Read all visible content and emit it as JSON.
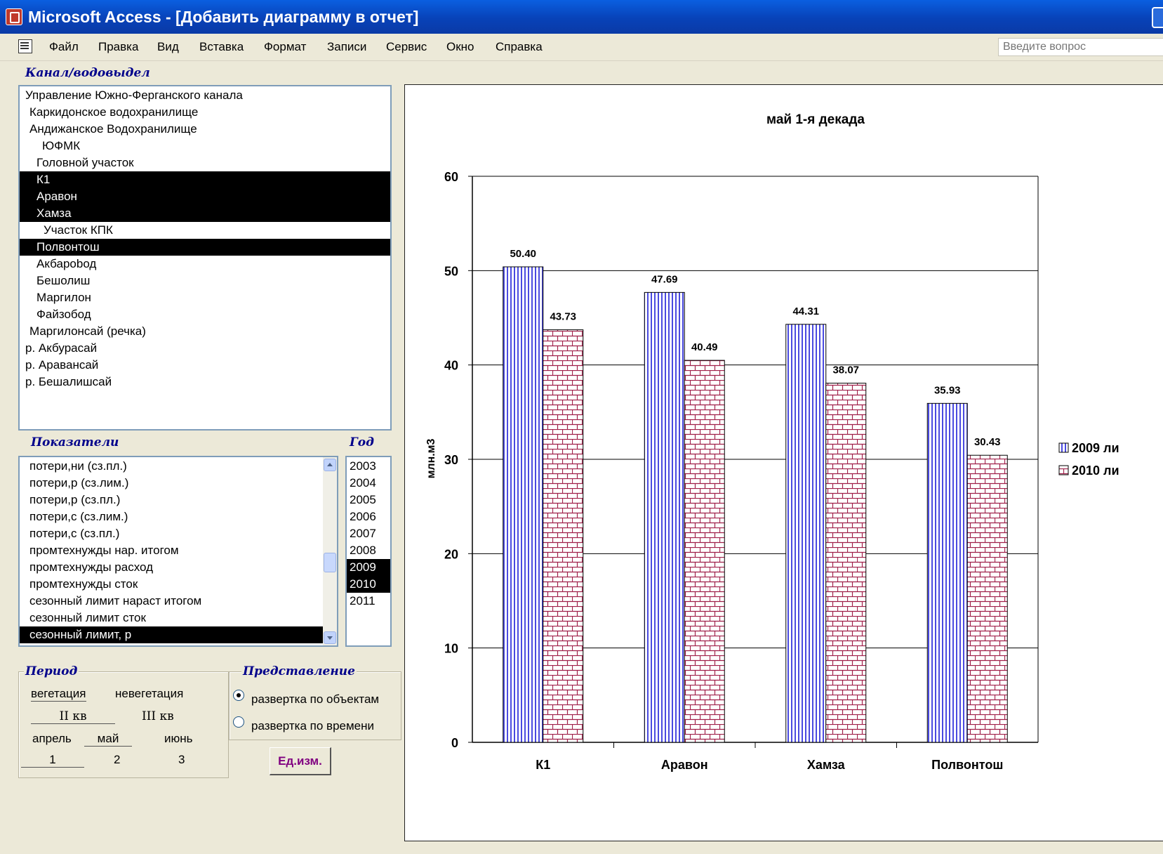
{
  "window": {
    "title": "Microsoft Access - [Добавить диаграмму в отчет]"
  },
  "menu": {
    "items": [
      "Файл",
      "Правка",
      "Вид",
      "Вставка",
      "Формат",
      "Записи",
      "Сервис",
      "Окно",
      "Справка"
    ],
    "help_placeholder": "Введите вопрос"
  },
  "channel": {
    "label": "Канал/водовыдел",
    "items": [
      {
        "label": "Управление Южно-Ферганского канала",
        "selected": false
      },
      {
        "label": "Каркидонское водохранилище",
        "selected": false
      },
      {
        "label": "Андижанское Водохранилище",
        "selected": false
      },
      {
        "label": "ЮФМК",
        "selected": false
      },
      {
        "label": "Головной участок",
        "selected": false
      },
      {
        "label": "К1",
        "selected": true
      },
      {
        "label": "Аравон",
        "selected": true
      },
      {
        "label": "Хамза",
        "selected": true
      },
      {
        "label": "Участок КПК",
        "selected": false
      },
      {
        "label": "Полвонтош",
        "selected": true
      },
      {
        "label": "Акбарobод",
        "selected": false
      },
      {
        "label": "Бешолиш",
        "selected": false
      },
      {
        "label": "Маргилон",
        "selected": false
      },
      {
        "label": "Файзобод",
        "selected": false
      },
      {
        "label": "Маргилонсай (речка)",
        "selected": false
      },
      {
        "label": "р. Акбурасай",
        "selected": false
      },
      {
        "label": "р. Аравансай",
        "selected": false
      },
      {
        "label": "р. Бешалишсай",
        "selected": false
      }
    ]
  },
  "indicators": {
    "label": "Показатели",
    "items": [
      {
        "label": "потери,ни (сз.пл.)",
        "selected": false
      },
      {
        "label": "потери,р (сз.лим.)",
        "selected": false
      },
      {
        "label": "потери,р (сз.пл.)",
        "selected": false
      },
      {
        "label": "потери,с (сз.лим.)",
        "selected": false
      },
      {
        "label": "потери,с (сз.пл.)",
        "selected": false
      },
      {
        "label": "промтехнужды нар. итогом",
        "selected": false
      },
      {
        "label": "промтехнужды расход",
        "selected": false
      },
      {
        "label": "промтехнужды сток",
        "selected": false
      },
      {
        "label": "сезонный лимит нараст итогом",
        "selected": false
      },
      {
        "label": "сезонный лимит сток",
        "selected": false
      },
      {
        "label": "сезонный лимит, р",
        "selected": true
      }
    ]
  },
  "year": {
    "label": "Год",
    "items": [
      {
        "label": "2003",
        "selected": false
      },
      {
        "label": "2004",
        "selected": false
      },
      {
        "label": "2005",
        "selected": false
      },
      {
        "label": "2006",
        "selected": false
      },
      {
        "label": "2007",
        "selected": false
      },
      {
        "label": "2008",
        "selected": false
      },
      {
        "label": "2009",
        "selected": true
      },
      {
        "label": "2010",
        "selected": true
      },
      {
        "label": "2011",
        "selected": false
      }
    ]
  },
  "period": {
    "label": "Период",
    "vegetation": "вегетация",
    "nonvegetation": "невегетация",
    "q2": "II кв",
    "q3": "III кв",
    "april": "апрель",
    "may": "май",
    "june": "июнь",
    "d1": "1",
    "d2": "2",
    "d3": "3"
  },
  "representation": {
    "label": "Представление",
    "options": [
      {
        "label": "развертка по объектам",
        "checked": true
      },
      {
        "label": "развертка по времени",
        "checked": false
      }
    ]
  },
  "units_button": "Ед.изм.",
  "colors": {
    "series_2009": "#4a4ae0",
    "series_2010": "#a0204a",
    "selection": "#000000",
    "section_label": "#00008b"
  },
  "chart_data": {
    "type": "bar",
    "title": "май 1-я декада",
    "ylabel": "млн.м3",
    "xlabel": "",
    "categories": [
      "К1",
      "Аравон",
      "Хамза",
      "Полвонтош"
    ],
    "series": [
      {
        "name": "2009 ли",
        "values": [
          50.4,
          47.69,
          44.31,
          35.93
        ],
        "labels": [
          "50.40",
          "47.69",
          "44.31",
          "35.93"
        ]
      },
      {
        "name": "2010 ли",
        "values": [
          43.73,
          40.49,
          38.07,
          30.43
        ],
        "labels": [
          "43.73",
          "40.49",
          "38.07",
          "30.43"
        ]
      }
    ],
    "ylim": [
      0,
      60
    ],
    "yticks": [
      "0",
      "10",
      "20",
      "30",
      "40",
      "50",
      "60"
    ],
    "grid": true,
    "legend": "right"
  }
}
